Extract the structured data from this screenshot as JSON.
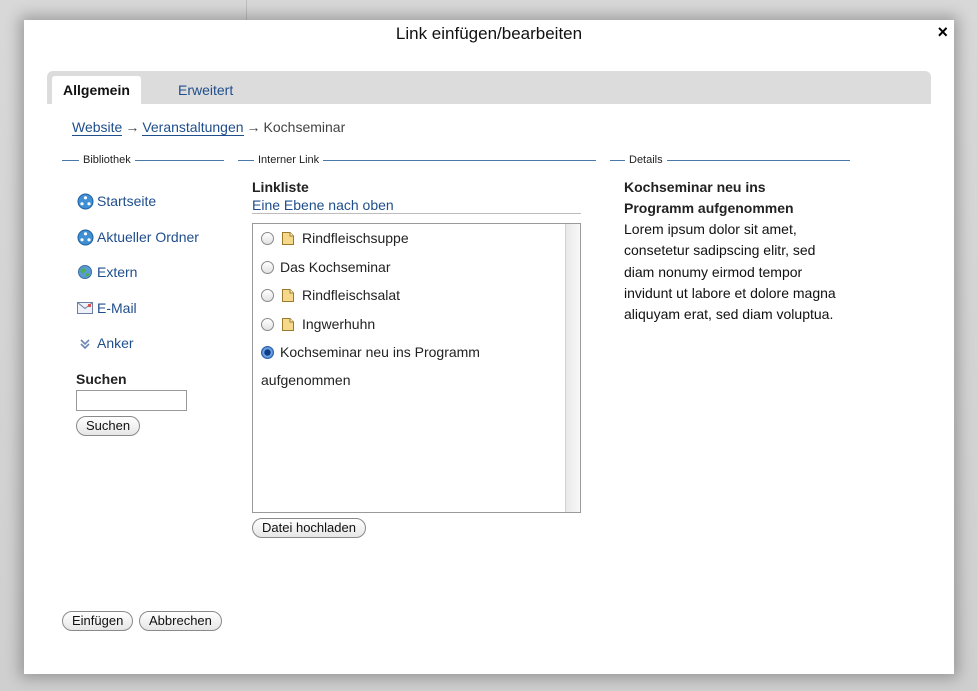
{
  "dialog": {
    "title": "Link einfügen/bearbeiten",
    "close_label": "×"
  },
  "tabs": [
    {
      "label": "Allgemein",
      "active": true
    },
    {
      "label": "Erweitert",
      "active": false
    }
  ],
  "breadcrumb": {
    "items": [
      "Website",
      "Veranstaltungen",
      "Kochseminar"
    ],
    "separator": "→"
  },
  "library": {
    "legend": "Bibliothek",
    "items": [
      {
        "label": "Startseite",
        "icon": "home-node-icon"
      },
      {
        "label": "Aktueller Ordner",
        "icon": "folder-node-icon"
      },
      {
        "label": "Extern",
        "icon": "globe-icon"
      },
      {
        "label": "E-Mail",
        "icon": "email-icon"
      },
      {
        "label": "Anker",
        "icon": "anchor-icon"
      }
    ],
    "search": {
      "heading": "Suchen",
      "value": "",
      "button_label": "Suchen"
    }
  },
  "internal_link": {
    "legend": "Interner Link",
    "list_title": "Linkliste",
    "level_up": "Eine Ebene nach oben",
    "items": [
      {
        "label": "Rindfleischsuppe",
        "has_doc_icon": true,
        "selected": false
      },
      {
        "label": "Das Kochseminar",
        "has_doc_icon": false,
        "selected": false
      },
      {
        "label": "Rindfleischsalat",
        "has_doc_icon": true,
        "selected": false
      },
      {
        "label": "Ingwerhuhn",
        "has_doc_icon": true,
        "selected": false
      },
      {
        "label": "Kochseminar neu ins Programm",
        "label_line2": "aufgenommen",
        "has_doc_icon": false,
        "selected": true
      }
    ],
    "upload_label": "Datei hochladen"
  },
  "details": {
    "legend": "Details",
    "heading": "Kochseminar neu ins Programm aufgenommen",
    "body": "Lorem ipsum dolor sit amet, consetetur sadipscing elitr, sed diam nonumy eirmod tempor invidunt ut labore et dolore magna aliquyam erat, sed diam voluptua."
  },
  "footer": {
    "insert_label": "Einfügen",
    "cancel_label": "Abbrechen"
  },
  "colors": {
    "link": "#1f4e8c",
    "legend_rule": "#4a78a8",
    "tabbar": "#dcdcdc",
    "selected_radio": "#3d78c7"
  }
}
